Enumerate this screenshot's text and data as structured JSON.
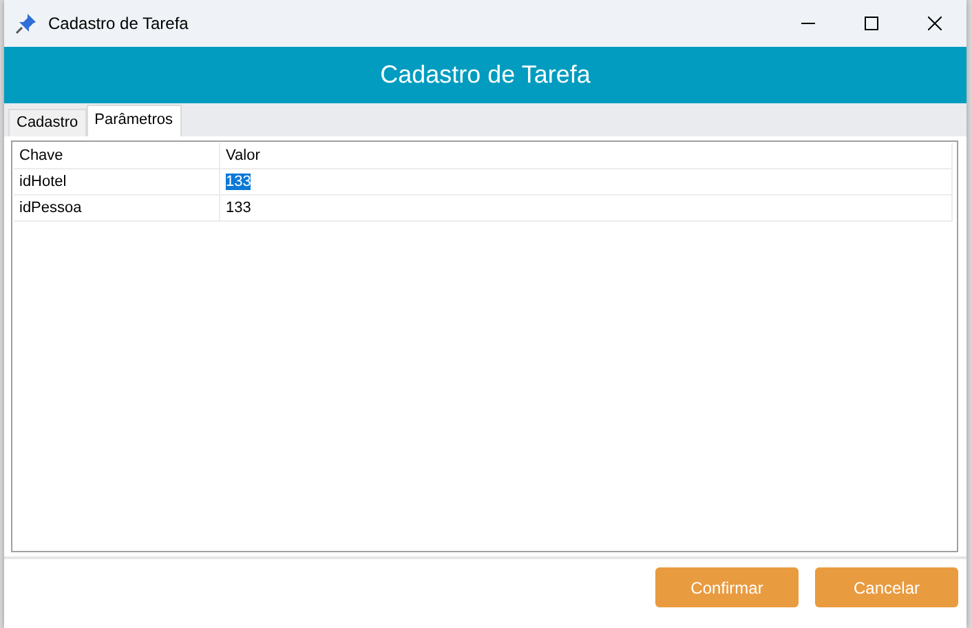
{
  "window": {
    "title": "Cadastro de Tarefa"
  },
  "header": {
    "title": "Cadastro de Tarefa"
  },
  "tabs": [
    {
      "label": "Cadastro",
      "selected": false
    },
    {
      "label": "Parâmetros",
      "selected": true
    }
  ],
  "table": {
    "columns": [
      "Chave",
      "Valor"
    ],
    "rows": [
      {
        "key": "idHotel",
        "value": "133",
        "selected": true
      },
      {
        "key": "idPessoa",
        "value": "133",
        "selected": false
      }
    ]
  },
  "buttons": [
    "Confirmar",
    "Cancelar"
  ]
}
